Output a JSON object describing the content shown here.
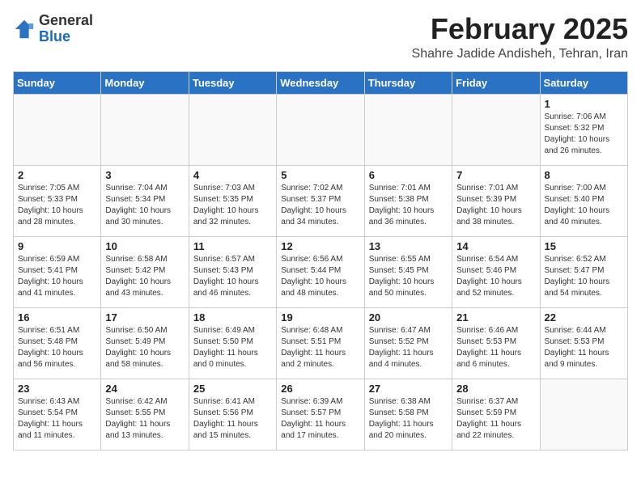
{
  "header": {
    "logo_line1": "General",
    "logo_line2": "Blue",
    "month_title": "February 2025",
    "subtitle": "Shahre Jadide Andisheh, Tehran, Iran"
  },
  "weekdays": [
    "Sunday",
    "Monday",
    "Tuesday",
    "Wednesday",
    "Thursday",
    "Friday",
    "Saturday"
  ],
  "weeks": [
    [
      {
        "day": "",
        "info": ""
      },
      {
        "day": "",
        "info": ""
      },
      {
        "day": "",
        "info": ""
      },
      {
        "day": "",
        "info": ""
      },
      {
        "day": "",
        "info": ""
      },
      {
        "day": "",
        "info": ""
      },
      {
        "day": "1",
        "info": "Sunrise: 7:06 AM\nSunset: 5:32 PM\nDaylight: 10 hours\nand 26 minutes."
      }
    ],
    [
      {
        "day": "2",
        "info": "Sunrise: 7:05 AM\nSunset: 5:33 PM\nDaylight: 10 hours\nand 28 minutes."
      },
      {
        "day": "3",
        "info": "Sunrise: 7:04 AM\nSunset: 5:34 PM\nDaylight: 10 hours\nand 30 minutes."
      },
      {
        "day": "4",
        "info": "Sunrise: 7:03 AM\nSunset: 5:35 PM\nDaylight: 10 hours\nand 32 minutes."
      },
      {
        "day": "5",
        "info": "Sunrise: 7:02 AM\nSunset: 5:37 PM\nDaylight: 10 hours\nand 34 minutes."
      },
      {
        "day": "6",
        "info": "Sunrise: 7:01 AM\nSunset: 5:38 PM\nDaylight: 10 hours\nand 36 minutes."
      },
      {
        "day": "7",
        "info": "Sunrise: 7:01 AM\nSunset: 5:39 PM\nDaylight: 10 hours\nand 38 minutes."
      },
      {
        "day": "8",
        "info": "Sunrise: 7:00 AM\nSunset: 5:40 PM\nDaylight: 10 hours\nand 40 minutes."
      }
    ],
    [
      {
        "day": "9",
        "info": "Sunrise: 6:59 AM\nSunset: 5:41 PM\nDaylight: 10 hours\nand 41 minutes."
      },
      {
        "day": "10",
        "info": "Sunrise: 6:58 AM\nSunset: 5:42 PM\nDaylight: 10 hours\nand 43 minutes."
      },
      {
        "day": "11",
        "info": "Sunrise: 6:57 AM\nSunset: 5:43 PM\nDaylight: 10 hours\nand 46 minutes."
      },
      {
        "day": "12",
        "info": "Sunrise: 6:56 AM\nSunset: 5:44 PM\nDaylight: 10 hours\nand 48 minutes."
      },
      {
        "day": "13",
        "info": "Sunrise: 6:55 AM\nSunset: 5:45 PM\nDaylight: 10 hours\nand 50 minutes."
      },
      {
        "day": "14",
        "info": "Sunrise: 6:54 AM\nSunset: 5:46 PM\nDaylight: 10 hours\nand 52 minutes."
      },
      {
        "day": "15",
        "info": "Sunrise: 6:52 AM\nSunset: 5:47 PM\nDaylight: 10 hours\nand 54 minutes."
      }
    ],
    [
      {
        "day": "16",
        "info": "Sunrise: 6:51 AM\nSunset: 5:48 PM\nDaylight: 10 hours\nand 56 minutes."
      },
      {
        "day": "17",
        "info": "Sunrise: 6:50 AM\nSunset: 5:49 PM\nDaylight: 10 hours\nand 58 minutes."
      },
      {
        "day": "18",
        "info": "Sunrise: 6:49 AM\nSunset: 5:50 PM\nDaylight: 11 hours\nand 0 minutes."
      },
      {
        "day": "19",
        "info": "Sunrise: 6:48 AM\nSunset: 5:51 PM\nDaylight: 11 hours\nand 2 minutes."
      },
      {
        "day": "20",
        "info": "Sunrise: 6:47 AM\nSunset: 5:52 PM\nDaylight: 11 hours\nand 4 minutes."
      },
      {
        "day": "21",
        "info": "Sunrise: 6:46 AM\nSunset: 5:53 PM\nDaylight: 11 hours\nand 6 minutes."
      },
      {
        "day": "22",
        "info": "Sunrise: 6:44 AM\nSunset: 5:53 PM\nDaylight: 11 hours\nand 9 minutes."
      }
    ],
    [
      {
        "day": "23",
        "info": "Sunrise: 6:43 AM\nSunset: 5:54 PM\nDaylight: 11 hours\nand 11 minutes."
      },
      {
        "day": "24",
        "info": "Sunrise: 6:42 AM\nSunset: 5:55 PM\nDaylight: 11 hours\nand 13 minutes."
      },
      {
        "day": "25",
        "info": "Sunrise: 6:41 AM\nSunset: 5:56 PM\nDaylight: 11 hours\nand 15 minutes."
      },
      {
        "day": "26",
        "info": "Sunrise: 6:39 AM\nSunset: 5:57 PM\nDaylight: 11 hours\nand 17 minutes."
      },
      {
        "day": "27",
        "info": "Sunrise: 6:38 AM\nSunset: 5:58 PM\nDaylight: 11 hours\nand 20 minutes."
      },
      {
        "day": "28",
        "info": "Sunrise: 6:37 AM\nSunset: 5:59 PM\nDaylight: 11 hours\nand 22 minutes."
      },
      {
        "day": "",
        "info": ""
      }
    ]
  ]
}
